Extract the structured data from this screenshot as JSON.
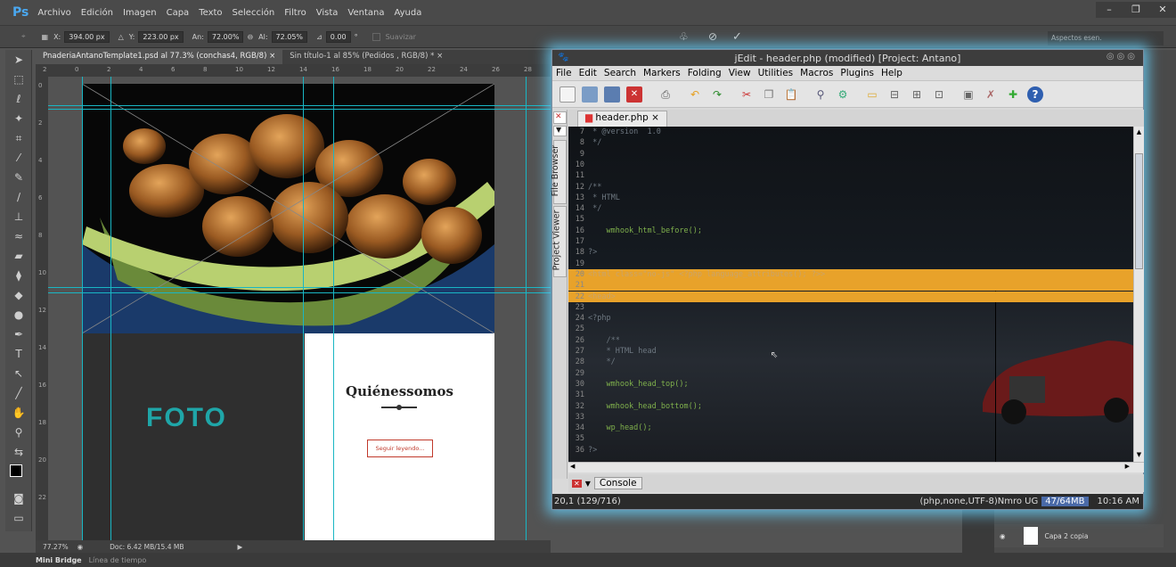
{
  "ps": {
    "logo": "Ps",
    "menu": [
      "Archivo",
      "Edición",
      "Imagen",
      "Capa",
      "Texto",
      "Selección",
      "Filtro",
      "Vista",
      "Ventana",
      "Ayuda"
    ],
    "options": {
      "x": "394.00 px",
      "y": "223.00 px",
      "w": "72.00%",
      "h": "72.05%",
      "angle": "0.00",
      "smooth": "Suavizar",
      "x_label": "X:",
      "y_label": "Y:",
      "w_label": "An:",
      "h_label": "Al:",
      "deg": "°"
    },
    "workspace": "Aspectos esen.",
    "tabs": [
      {
        "label": "PnaderiaAntanoTemplate1.psd al 77.3% (conchas4, RGB/8)",
        "close": "×"
      },
      {
        "label": "Sin título-1 al 85% (Pedidos , RGB/8) *",
        "close": "×"
      }
    ],
    "ruler_h": [
      "2",
      "0",
      "2",
      "4",
      "6",
      "8",
      "10",
      "12",
      "14",
      "16",
      "18",
      "20",
      "22",
      "24",
      "26",
      "28"
    ],
    "ruler_v": [
      "0",
      "2",
      "4",
      "6",
      "8",
      "10",
      "12",
      "14",
      "16",
      "18",
      "20",
      "22"
    ],
    "canvas": {
      "foto": "FOTO",
      "heading": "Quiénessomos",
      "button": "Seguir leyendo..."
    },
    "status": {
      "zoom": "77.27%",
      "doc": "Doc: 6.42 MB/15.4 MB"
    },
    "bottom": {
      "minibridge": "Mini Bridge",
      "timeline": "Línea de tiempo"
    },
    "layer": "Capa 2 copia"
  },
  "jedit": {
    "title": "jEdit - header.php (modified) [Project: Antano]",
    "menu": [
      "File",
      "Edit",
      "Search",
      "Markers",
      "Folding",
      "View",
      "Utilities",
      "Macros",
      "Plugins",
      "Help"
    ],
    "tab": "header.php",
    "tab_close": "×",
    "side_tabs": [
      "File Browser",
      "Project Viewer"
    ],
    "console": "Console",
    "status_left": "20,1 (129/716)",
    "status_mode": "(php,none,UTF-8)Nmro UG",
    "status_mem": "47/64MB",
    "status_time": "10:16 AM",
    "lines": [
      {
        "n": "7",
        "t": " * @version  1.0",
        "c": "cmt"
      },
      {
        "n": "8",
        "t": " */",
        "c": "cmt"
      },
      {
        "n": "9",
        "t": "",
        "c": "code"
      },
      {
        "n": "10",
        "t": "",
        "c": "code"
      },
      {
        "n": "11",
        "t": "",
        "c": "code"
      },
      {
        "n": "12",
        "t": "/**",
        "c": "cmt"
      },
      {
        "n": "13",
        "t": " * HTML",
        "c": "cmt"
      },
      {
        "n": "14",
        "t": " */",
        "c": "cmt"
      },
      {
        "n": "15",
        "t": "",
        "c": "code"
      },
      {
        "n": "16",
        "t": "    wmhook_html_before();",
        "c": "code"
      },
      {
        "n": "17",
        "t": "",
        "c": "code"
      },
      {
        "n": "18",
        "t": "?>",
        "c": "cmt"
      },
      {
        "n": "19",
        "t": "",
        "c": "code"
      },
      {
        "n": "20",
        "t": "<html class=\"no-js\" <?php language_attributes(); ?>>",
        "c": "hl"
      },
      {
        "n": "21",
        "t": "",
        "c": "hl"
      },
      {
        "n": "22",
        "t": "<head>",
        "c": "hl"
      },
      {
        "n": "23",
        "t": "",
        "c": "code"
      },
      {
        "n": "24",
        "t": "<?php",
        "c": "cmt"
      },
      {
        "n": "25",
        "t": "",
        "c": "code"
      },
      {
        "n": "26",
        "t": "    /**",
        "c": "cmt"
      },
      {
        "n": "27",
        "t": "    * HTML head",
        "c": "cmt"
      },
      {
        "n": "28",
        "t": "    */",
        "c": "cmt"
      },
      {
        "n": "29",
        "t": "",
        "c": "code"
      },
      {
        "n": "30",
        "t": "    wmhook_head_top();",
        "c": "code"
      },
      {
        "n": "31",
        "t": "",
        "c": "code"
      },
      {
        "n": "32",
        "t": "    wmhook_head_bottom();",
        "c": "code"
      },
      {
        "n": "33",
        "t": "",
        "c": "code"
      },
      {
        "n": "34",
        "t": "    wp_head();",
        "c": "code"
      },
      {
        "n": "35",
        "t": "",
        "c": "code"
      },
      {
        "n": "36",
        "t": "?>",
        "c": "cmt"
      }
    ]
  }
}
